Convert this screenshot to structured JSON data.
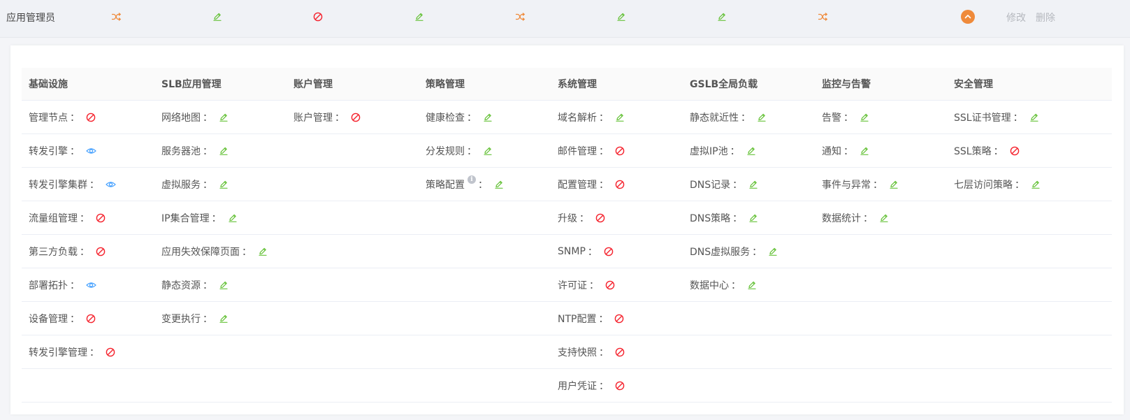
{
  "role": {
    "name": "应用管理员",
    "summary": [
      {
        "key": "基础设施",
        "icon": "shuffle-icon"
      },
      {
        "key": "SLB应用管理",
        "icon": "edit-icon"
      },
      {
        "key": "账户管理",
        "icon": "forbidden-icon"
      },
      {
        "key": "策略管理",
        "icon": "edit-icon"
      },
      {
        "key": "系统管理",
        "icon": "shuffle-icon"
      },
      {
        "key": "GSLB全局负载",
        "icon": "edit-icon"
      },
      {
        "key": "监控与告警",
        "icon": "edit-icon"
      },
      {
        "key": "安全管理",
        "icon": "shuffle-icon"
      }
    ],
    "collapse_icon": "chevron-up-icon",
    "edit_label": "修改",
    "delete_label": "删除"
  },
  "colors": {
    "edit": "#67c23a",
    "forbidden": "#f5222d",
    "view": "#409eff",
    "shuffle": "#ef8a3a",
    "accent": "#ef8a3a"
  },
  "columns": [
    "基础设施",
    "SLB应用管理",
    "账户管理",
    "策略管理",
    "系统管理",
    "GSLB全局负载",
    "监控与告警",
    "安全管理"
  ],
  "rows": [
    [
      {
        "label": "管理节点",
        "icon": "forbidden-icon"
      },
      {
        "label": "网络地图",
        "icon": "edit-icon"
      },
      {
        "label": "账户管理",
        "icon": "forbidden-icon"
      },
      {
        "label": "健康检查",
        "icon": "edit-icon"
      },
      {
        "label": "域名解析",
        "icon": "edit-icon"
      },
      {
        "label": "静态就近性",
        "icon": "edit-icon"
      },
      {
        "label": "告警",
        "icon": "edit-icon"
      },
      {
        "label": "SSL证书管理",
        "icon": "edit-icon"
      }
    ],
    [
      {
        "label": "转发引擎",
        "icon": "eye-icon"
      },
      {
        "label": "服务器池",
        "icon": "edit-icon"
      },
      null,
      {
        "label": "分发规则",
        "icon": "edit-icon"
      },
      {
        "label": "邮件管理",
        "icon": "forbidden-icon"
      },
      {
        "label": "虚拟IP池",
        "icon": "edit-icon"
      },
      {
        "label": "通知",
        "icon": "edit-icon"
      },
      {
        "label": "SSL策略",
        "icon": "forbidden-icon"
      }
    ],
    [
      {
        "label": "转发引擎集群",
        "icon": "eye-icon"
      },
      {
        "label": "虚拟服务",
        "icon": "edit-icon"
      },
      null,
      {
        "label": "策略配置",
        "icon": "edit-icon",
        "info": "i"
      },
      {
        "label": "配置管理",
        "icon": "forbidden-icon"
      },
      {
        "label": "DNS记录",
        "icon": "edit-icon"
      },
      {
        "label": "事件与异常",
        "icon": "edit-icon"
      },
      {
        "label": "七层访问策略",
        "icon": "edit-icon"
      }
    ],
    [
      {
        "label": "流量组管理",
        "icon": "forbidden-icon"
      },
      {
        "label": "IP集合管理",
        "icon": "edit-icon"
      },
      null,
      null,
      {
        "label": "升级",
        "icon": "forbidden-icon"
      },
      {
        "label": "DNS策略",
        "icon": "edit-icon"
      },
      {
        "label": "数据统计",
        "icon": "edit-icon"
      },
      null
    ],
    [
      {
        "label": "第三方负载",
        "icon": "forbidden-icon"
      },
      {
        "label": "应用失效保障页面",
        "icon": "edit-icon"
      },
      null,
      null,
      {
        "label": "SNMP",
        "icon": "forbidden-icon"
      },
      {
        "label": "DNS虚拟服务",
        "icon": "edit-icon"
      },
      null,
      null
    ],
    [
      {
        "label": "部署拓扑",
        "icon": "eye-icon"
      },
      {
        "label": "静态资源",
        "icon": "edit-icon"
      },
      null,
      null,
      {
        "label": "许可证",
        "icon": "forbidden-icon"
      },
      {
        "label": "数据中心",
        "icon": "edit-icon"
      },
      null,
      null
    ],
    [
      {
        "label": "设备管理",
        "icon": "forbidden-icon"
      },
      {
        "label": "变更执行",
        "icon": "edit-icon"
      },
      null,
      null,
      {
        "label": "NTP配置",
        "icon": "forbidden-icon"
      },
      null,
      null,
      null
    ],
    [
      {
        "label": "转发引擎管理",
        "icon": "forbidden-icon"
      },
      null,
      null,
      null,
      {
        "label": "支持快照",
        "icon": "forbidden-icon"
      },
      null,
      null,
      null
    ],
    [
      null,
      null,
      null,
      null,
      {
        "label": "用户凭证",
        "icon": "forbidden-icon"
      },
      null,
      null,
      null
    ]
  ],
  "colon": "："
}
